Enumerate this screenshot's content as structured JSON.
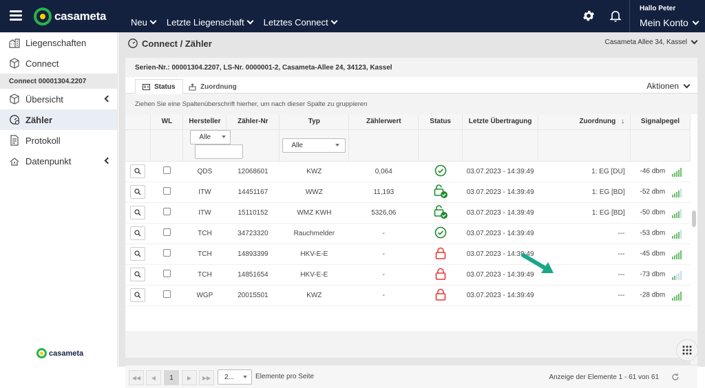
{
  "header": {
    "nav": [
      "Neu",
      "Letzte Liegenschaft",
      "Letztes Connect"
    ],
    "greeting": "Hallo Peter",
    "account": "Mein Konto",
    "logo": "casameta"
  },
  "sidebar": {
    "items": [
      {
        "label": "Liegenschaften",
        "icon": "buildings-icon"
      },
      {
        "label": "Connect",
        "icon": "cube-icon"
      }
    ],
    "group": "Connect 00001304.2207",
    "sub": [
      {
        "label": "Übersicht",
        "icon": "cube-icon"
      },
      {
        "label": "Zähler",
        "icon": "meter-icon"
      },
      {
        "label": "Protokoll",
        "icon": "document-icon"
      },
      {
        "label": "Datenpunkt",
        "icon": "network-icon"
      }
    ],
    "logo": "casameta"
  },
  "page": {
    "breadcrumb": "Connect / Zähler",
    "address": "Casameta Allee 34, Kassel",
    "serial": "Serien-Nr.: 00001304.2207, LS-Nr. 0000001-2, Casameta-Allee 24, 34123, Kassel",
    "tabs": [
      "Status",
      "Zuordnung"
    ],
    "actions": "Aktionen",
    "group_hint": "Ziehen Sie eine Spaltenüberschrift hierher, um nach dieser Spalte zu gruppieren"
  },
  "table": {
    "headers": [
      "",
      "WL",
      "Hersteller",
      "Zähler-Nr",
      "Typ",
      "Zählerwert",
      "Status",
      "Letzte Übertragung",
      "Zuordnung",
      "Signalpegel"
    ],
    "sort_indicator": "↓",
    "filter_all": "Alle",
    "rows": [
      {
        "hersteller": "QDS",
        "nr": "12068601",
        "typ": "KWZ",
        "wert": "0,064",
        "status": "ok",
        "zeit": "03.07.2023 - 14:39:49",
        "zuordnung": "1: EG [DU]",
        "signal": "-46 dbm",
        "bars": 5
      },
      {
        "hersteller": "ITW",
        "nr": "14451167",
        "typ": "WWZ",
        "wert": "11,193",
        "status": "unlocked",
        "zeit": "03.07.2023 - 14:39:49",
        "zuordnung": "1: EG [BD]",
        "signal": "-52 dbm",
        "bars": 4
      },
      {
        "hersteller": "ITW",
        "nr": "15110152",
        "typ": "WMZ KWH",
        "wert": "5326,06",
        "status": "unlocked",
        "zeit": "03.07.2023 - 14:39:49",
        "zuordnung": "1: EG [BD]",
        "signal": "-50 dbm",
        "bars": 4
      },
      {
        "hersteller": "TCH",
        "nr": "34723320",
        "typ": "Rauchmelder",
        "wert": "-",
        "status": "ok",
        "zeit": "03.07.2023 - 14:39:49",
        "zuordnung": "---",
        "signal": "-53 dbm",
        "bars": 4
      },
      {
        "hersteller": "TCH",
        "nr": "14893399",
        "typ": "HKV-E-E",
        "wert": "-",
        "status": "locked",
        "zeit": "03.07.2023 - 14:39:49",
        "zuordnung": "---",
        "signal": "-45 dbm",
        "bars": 5
      },
      {
        "hersteller": "TCH",
        "nr": "14851654",
        "typ": "HKV-E-E",
        "wert": "-",
        "status": "locked",
        "zeit": "03.07.2023 - 14:39:49",
        "zuordnung": "---",
        "signal": "-73 dbm",
        "bars": 2
      },
      {
        "hersteller": "WGP",
        "nr": "20015501",
        "typ": "KWZ",
        "wert": "-",
        "status": "locked",
        "zeit": "03.07.2023 - 14:39:49",
        "zuordnung": "---",
        "signal": "-28 dbm",
        "bars": 5
      }
    ]
  },
  "pager": {
    "page": "1",
    "page_size": "2...",
    "page_size_label": "Elemente pro Seite",
    "info": "Anzeige der Elemente 1 - 61 von 61"
  },
  "colors": {
    "header_bg": "#13213f",
    "brand_green": "#2ab24b",
    "brand_yellow": "#f5d000",
    "ok_green": "#1f8a2e",
    "locked_red": "#e53935",
    "arrow": "#1aa689"
  }
}
